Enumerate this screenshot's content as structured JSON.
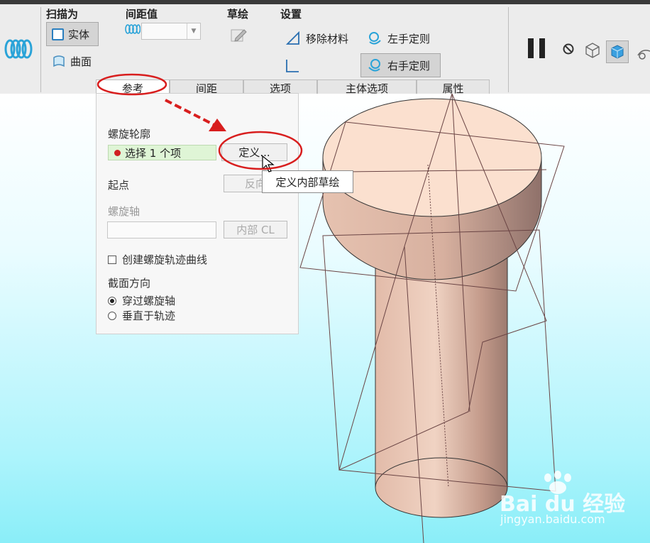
{
  "ribbon": {
    "groups": {
      "sweep_as": {
        "header": "扫描为",
        "solid_label": "实体",
        "surface_label": "曲面"
      },
      "pitch": {
        "header": "间距值"
      },
      "sketch": {
        "header": "草绘"
      },
      "settings": {
        "header": "设置",
        "remove_material_label": "移除材料",
        "left_hand_label": "左手定则",
        "right_hand_label": "右手定则"
      }
    }
  },
  "tabs": [
    {
      "label": "参考",
      "active": true
    },
    {
      "label": "间距",
      "active": false
    },
    {
      "label": "选项",
      "active": false
    },
    {
      "label": "主体选项",
      "active": false
    },
    {
      "label": "属性",
      "active": false
    }
  ],
  "panel": {
    "helix_profile": {
      "label": "螺旋轮廓",
      "collector_text": "选择 1 个项",
      "define_button": "定义..."
    },
    "start_point": {
      "label": "起点",
      "flip_button": "反向"
    },
    "helix_axis": {
      "label": "螺旋轴",
      "internal_cl_button": "内部 CL"
    },
    "create_curve_label": "创建螺旋轨迹曲线",
    "section_orientation": {
      "label": "截面方向",
      "options": [
        {
          "label": "穿过螺旋轴",
          "selected": true
        },
        {
          "label": "垂直于轨迹",
          "selected": false
        }
      ]
    }
  },
  "tooltip": "定义内部草绘",
  "watermark": {
    "brand": "Bai du 经验",
    "url": "jingyan.baidu.com"
  },
  "colors": {
    "annotation_red": "#d81e1e",
    "collector_bg": "#dff5d6",
    "cylinder_top": "#fbe0cf",
    "cylinder_side": "#d9b3a3"
  }
}
